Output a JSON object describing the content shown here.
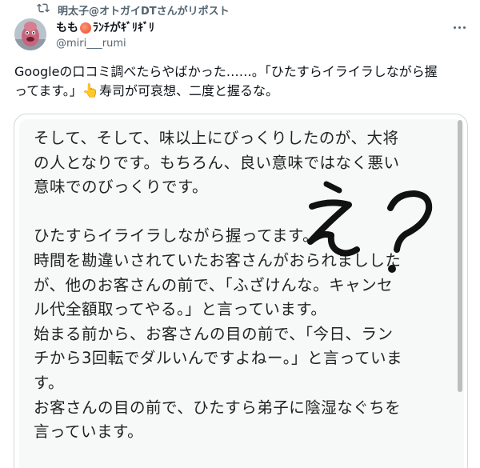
{
  "repost": {
    "text": "明太子@オトガイDTさんがリポスト",
    "icon": "repost-icon"
  },
  "author": {
    "display_name_prefix": "もも",
    "display_name_suffix": "ﾗﾝﾁがｷﾞﾘｷﾞﾘ",
    "handle": "@miri___rumi",
    "emoji_icon": "peach-icon"
  },
  "more_icon": "more-dots-icon",
  "tweet": {
    "line1": "Googleの口コミ調べたらやばかった……。「ひたすらイライラしながら握",
    "line2_a": "ってます。」",
    "line2_emoji": "👆",
    "line2_b": "寿司が可哀想、二度と握るな。"
  },
  "image_text": {
    "lines": [
      "そして、そして、味以上にびっくりしたのが、大将",
      "の人となりです。もちろん、良い意味ではなく悪い",
      "意味でのびっくりです。",
      "",
      "ひたすらイライラしながら握ってます。",
      "時間を勘違いされていたお客さんがおられましした",
      "が、他のお客さんの前で、「ふざけんな。キャンセ",
      "ル代全額取ってやる。」と言っています。",
      "始まる前から、お客さんの目の前で、「今日、ラン",
      "チから3回転でダルいんですよねー。」と言っていま",
      "す。",
      "お客さんの目の前で、ひたすら弟子に陰湿なぐちを",
      "言っています。"
    ],
    "handwritten": "え？"
  },
  "colors": {
    "secondary_text": "#536471",
    "border": "#cfd9de",
    "text": "#0f1419"
  }
}
